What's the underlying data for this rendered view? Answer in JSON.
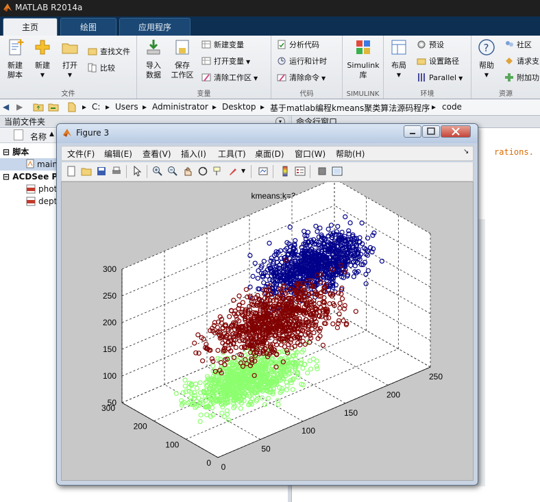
{
  "app": {
    "title": "MATLAB R2014a"
  },
  "tabs": [
    {
      "label": "主页",
      "active": true
    },
    {
      "label": "绘图"
    },
    {
      "label": "应用程序"
    }
  ],
  "ribbon": {
    "file_group": {
      "label": "文件",
      "new_script": "新建\n脚本",
      "new": "新建",
      "open": "打开",
      "find_files": "查找文件",
      "compare": "比较"
    },
    "variable_group": {
      "label": "变量",
      "import": "导入\n数据",
      "save_ws": "保存\n工作区",
      "new_var": "新建变量",
      "open_var": "打开变量",
      "clear_ws": "清除工作区"
    },
    "code_group": {
      "label": "代码",
      "analyze": "分析代码",
      "run_time": "运行和计时",
      "clear_cmd": "清除命令"
    },
    "simulink_group": {
      "label": "SIMULINK",
      "simulink": "Simulink\n库"
    },
    "env_group": {
      "label": "环境",
      "layout": "布局",
      "prefs": "预设",
      "set_path": "设置路径",
      "parallel": "Parallel"
    },
    "resources_group": {
      "label": "资源",
      "help": "帮助",
      "community": "社区",
      "request": "请求支",
      "addons": "附加功"
    }
  },
  "address": {
    "parts": [
      "C:",
      "Users",
      "Administrator",
      "Desktop",
      "基于matlab编程kmeans聚类算法源码程序",
      "code"
    ]
  },
  "left_pane": {
    "title": "当前文件夹",
    "col_name": "名称",
    "sections": [
      {
        "label": "脚本",
        "items": [
          "main"
        ]
      },
      {
        "label": "ACDSee PI",
        "items": [
          "phot",
          "dept"
        ]
      }
    ]
  },
  "cmd_pane": {
    "title": "命令行窗口",
    "text": "rations."
  },
  "figure": {
    "title": "Figure 3",
    "menu": [
      "文件(F)",
      "编辑(E)",
      "查看(V)",
      "插入(I)",
      "工具(T)",
      "桌面(D)",
      "窗口(W)",
      "帮助(H)"
    ],
    "menu_arrow": "↘"
  },
  "colors": {
    "cluster1": "#00008b",
    "cluster2": "#800000",
    "cluster3": "#8cff6e"
  },
  "chart_data": {
    "type": "scatter",
    "title": "kmeans:k=3",
    "xlabel": "",
    "ylabel": "",
    "zlabel": "",
    "x_ticks": [
      0,
      50,
      100,
      150,
      200,
      250
    ],
    "y_ticks": [
      0,
      100,
      200,
      300
    ],
    "z_ticks": [
      50,
      100,
      150,
      200,
      250,
      300
    ],
    "xlim": [
      0,
      250
    ],
    "ylim": [
      0,
      300
    ],
    "zlim": [
      50,
      300
    ],
    "grid": true,
    "series": [
      {
        "color": "#00008b",
        "centroid": [
          200,
          230,
          200
        ]
      },
      {
        "color": "#800000",
        "centroid": [
          130,
          170,
          160
        ]
      },
      {
        "color": "#8cff6e",
        "centroid": [
          80,
          120,
          100
        ]
      }
    ]
  }
}
